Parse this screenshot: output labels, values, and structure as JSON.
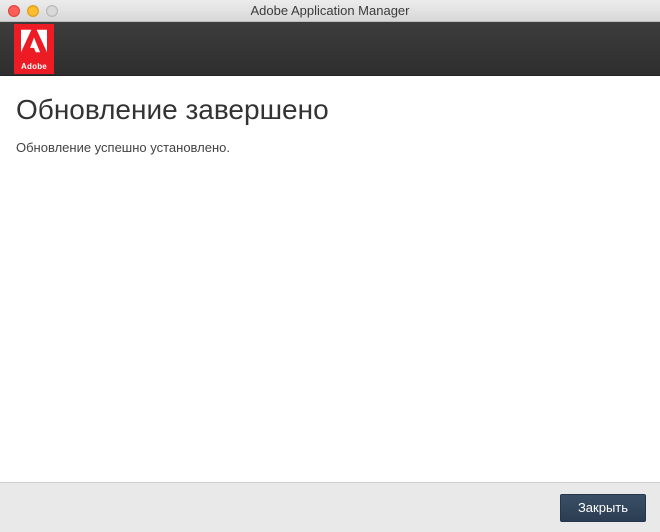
{
  "titlebar": {
    "title": "Adobe Application Manager"
  },
  "header": {
    "logo_label": "Adobe"
  },
  "content": {
    "heading": "Обновление завершено",
    "message": "Обновление успешно установлено."
  },
  "footer": {
    "close_label": "Закрыть"
  }
}
